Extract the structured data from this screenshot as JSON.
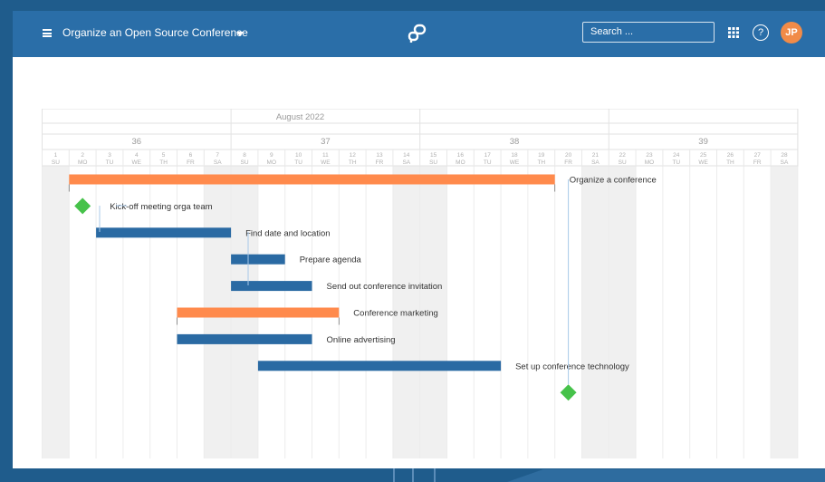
{
  "header": {
    "project_title": "Organize an Open Source Conference",
    "search_placeholder": "Search ...",
    "avatar_initials": "JP",
    "help_label": "?"
  },
  "colors": {
    "header_bg": "#2a6ea8",
    "work_package": "#2a6aa3",
    "phase": "#ff8a4c",
    "milestone": "#46c24a",
    "avatar": "#f18b48"
  },
  "timeline": {
    "month": "August 2022",
    "weeks": [
      "36",
      "37",
      "38",
      "39"
    ],
    "days": [
      {
        "n": "1",
        "d": "SU"
      },
      {
        "n": "2",
        "d": "MO"
      },
      {
        "n": "3",
        "d": "TU"
      },
      {
        "n": "4",
        "d": "WE"
      },
      {
        "n": "5",
        "d": "TH"
      },
      {
        "n": "6",
        "d": "FR"
      },
      {
        "n": "7",
        "d": "SA"
      },
      {
        "n": "8",
        "d": "SU"
      },
      {
        "n": "9",
        "d": "MO"
      },
      {
        "n": "10",
        "d": "TU"
      },
      {
        "n": "11",
        "d": "WE"
      },
      {
        "n": "12",
        "d": "TH"
      },
      {
        "n": "13",
        "d": "FR"
      },
      {
        "n": "14",
        "d": "SA"
      },
      {
        "n": "15",
        "d": "SU"
      },
      {
        "n": "16",
        "d": "MO"
      },
      {
        "n": "17",
        "d": "TU"
      },
      {
        "n": "18",
        "d": "WE"
      },
      {
        "n": "19",
        "d": "TH"
      },
      {
        "n": "20",
        "d": "FR"
      },
      {
        "n": "21",
        "d": "SA"
      },
      {
        "n": "22",
        "d": "SU"
      },
      {
        "n": "23",
        "d": "MO"
      },
      {
        "n": "24",
        "d": "TU"
      },
      {
        "n": "25",
        "d": "WE"
      },
      {
        "n": "26",
        "d": "TH"
      },
      {
        "n": "27",
        "d": "FR"
      },
      {
        "n": "28",
        "d": "SA"
      }
    ],
    "items": [
      {
        "type": "phase",
        "label": "Organize a conference",
        "start": "2",
        "end": "19"
      },
      {
        "type": "milestone",
        "label": "Kick-off meeting orga team",
        "date": "2"
      },
      {
        "type": "task",
        "label": "Find date and location",
        "start": "3",
        "end": "7"
      },
      {
        "type": "task",
        "label": "Prepare agenda",
        "start": "8",
        "end": "9"
      },
      {
        "type": "task",
        "label": "Send out conference invitation",
        "start": "8",
        "end": "10"
      },
      {
        "type": "phase",
        "label": "Conference marketing",
        "start": "6",
        "end": "11"
      },
      {
        "type": "task",
        "label": "Online advertising",
        "start": "6",
        "end": "10"
      },
      {
        "type": "task",
        "label": "Set up conference technology",
        "start": "9",
        "end": "17"
      },
      {
        "type": "milestone",
        "label": "",
        "date": "20"
      }
    ]
  }
}
